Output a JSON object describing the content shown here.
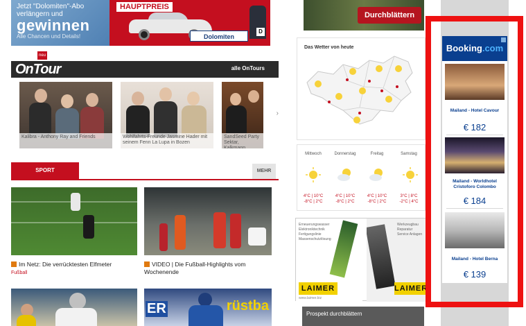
{
  "top_banner": {
    "line1": "Jetzt \"Dolomiten\"-Abo",
    "line2": "verlängern und",
    "line3": "gewinnen",
    "line4": "Alle Chancen und Details!",
    "prize_label": "HAUPTPREIS",
    "brand": "Dolomiten"
  },
  "ontour": {
    "badge": "neu",
    "title": "OnTour",
    "all_link": "alle OnTours",
    "photos": [
      {
        "caption": "Kalibra - Anthony Ray and Friends"
      },
      {
        "caption": "Wohlfahrts-Freunde Jasmine Hader mit seinem Fenn La Lupa in Bozen"
      },
      {
        "caption": "SandSeed Party Sektar, Kalkmann"
      }
    ]
  },
  "sport": {
    "tab_label": "SPORT",
    "more_label": "MEHR",
    "items": [
      {
        "title": "Im Netz: Die verrücktesten Elfmeter",
        "category": "Fußball"
      },
      {
        "title": "VIDEO | Die Fußball-Highlights vom Wochenende",
        "category": ""
      }
    ],
    "thumb3_text": "",
    "thumb4_text_left": "ER",
    "thumb4_text_right": "rüstba"
  },
  "middle": {
    "blaettern_label": "Durchblättern",
    "weather_title": "Das Wetter von heute",
    "forecast": [
      {
        "day": "Mittwoch",
        "temp_hi": "4°C | 10°C",
        "temp_lo": "-8°C | 2°C"
      },
      {
        "day": "Donnerstag",
        "temp_hi": "4°C | 10°C",
        "temp_lo": "-8°C | 2°C"
      },
      {
        "day": "Freitag",
        "temp_hi": "4°C | 10°C",
        "temp_lo": "-8°C | 2°C"
      },
      {
        "day": "Samstag",
        "temp_hi": "3°C | 8°C",
        "temp_lo": "-2°C | 4°C"
      }
    ],
    "laimer_left_text": "Erneuerungswasser Elektroniktechnik Fertigungslinie Massenschutzlösung",
    "laimer_right_text": "Werkzeugbau Reparatur Service Anlagen",
    "laimer_logo": "LAIMER",
    "laimer_url": "www.laimer.biz",
    "prospekt_label": "Prospekt durchblättern"
  },
  "booking": {
    "logo_main": "Booking",
    "logo_dot": ".com",
    "hotels": [
      {
        "name": "Mailand - Hotel Cavour",
        "price": "€ 182"
      },
      {
        "name": "Mailand - Worldhotel Cristoforo Colombo",
        "price": "€ 184"
      },
      {
        "name": "Mailand - Hotel Berna",
        "price": "€ 139"
      }
    ]
  },
  "colors": {
    "accent_red": "#c40f1f",
    "booking_blue": "#0a3f8f",
    "highlight_red": "#ee1111"
  }
}
